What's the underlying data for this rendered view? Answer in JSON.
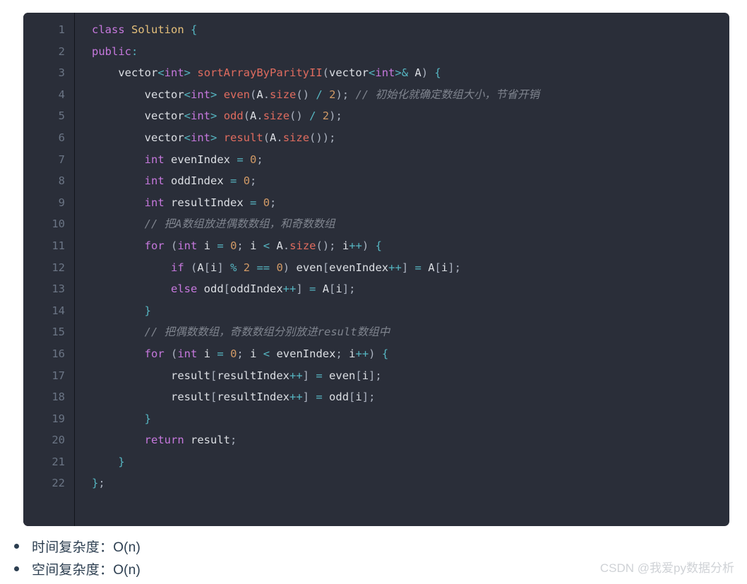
{
  "page": {
    "background_color": "#ffffff"
  },
  "code_block": {
    "language": "cpp",
    "background_color": "#2a2e39",
    "gutter_color": "#6b7585",
    "line_numbers": [
      "1",
      "2",
      "3",
      "4",
      "5",
      "6",
      "7",
      "8",
      "9",
      "10",
      "11",
      "12",
      "13",
      "14",
      "15",
      "16",
      "17",
      "18",
      "19",
      "20",
      "21",
      "22"
    ],
    "theme_colors": {
      "keyword": "#c678dd",
      "class_name": "#e5c07b",
      "function": "#e06c5f",
      "number": "#d19a66",
      "operator": "#56b6c2",
      "variable": "#dcdfe4",
      "comment": "#7f848e",
      "punctuation": "#abb2bf"
    },
    "lines": [
      "class Solution {",
      "public:",
      "    vector<int> sortArrayByParityII(vector<int>& A) {",
      "        vector<int> even(A.size() / 2); // 初始化就确定数组大小，节省开销",
      "        vector<int> odd(A.size() / 2);",
      "        vector<int> result(A.size());",
      "        int evenIndex = 0;",
      "        int oddIndex = 0;",
      "        int resultIndex = 0;",
      "        // 把A数组放进偶数数组，和奇数数组",
      "        for (int i = 0; i < A.size(); i++) {",
      "            if (A[i] % 2 == 0) even[evenIndex++] = A[i];",
      "            else odd[oddIndex++] = A[i];",
      "        }",
      "        // 把偶数数组，奇数数组分别放进result数组中",
      "        for (int i = 0; i < evenIndex; i++) {",
      "            result[resultIndex++] = even[i];",
      "            result[resultIndex++] = odd[i];",
      "        }",
      "        return result;",
      "    }",
      "};",
      ""
    ]
  },
  "notes": {
    "items": [
      {
        "label": "时间复杂度：O(n)"
      },
      {
        "label": "空间复杂度：O(n)"
      }
    ],
    "text_color": "#2c3e50"
  },
  "watermark": {
    "text": "CSDN @我爱py数据分析",
    "color": "#cfd2d6"
  }
}
